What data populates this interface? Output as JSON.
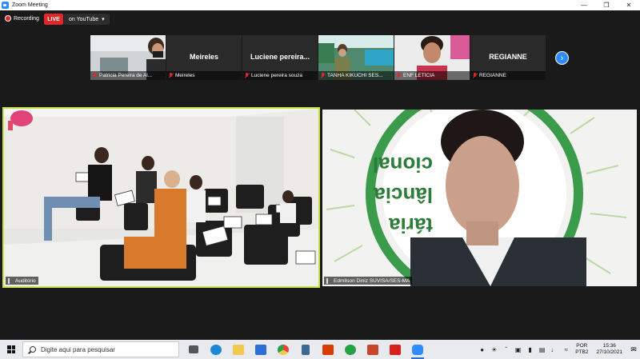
{
  "window": {
    "title": "Zoom Meeting"
  },
  "toolbar": {
    "recording_label": "Recording",
    "live_label": "LIVE",
    "stream_target": "on YouTube"
  },
  "participants": [
    {
      "name": "Patricia Pereira de Al...",
      "display": "",
      "has_video": true
    },
    {
      "name": "Meireles",
      "display": "Meireles",
      "has_video": false
    },
    {
      "name": "Luciene pereira souza",
      "display": "Luciene pereira...",
      "has_video": false
    },
    {
      "name": "TANHA KIKUCHI  SES...",
      "display": "",
      "has_video": true
    },
    {
      "name": "ENF LETÍCIA",
      "display": "",
      "has_video": true
    },
    {
      "name": "REGIANNE",
      "display": "REGIANNE",
      "has_video": false
    }
  ],
  "main_videos": [
    {
      "name": "Auditório"
    },
    {
      "name": "Edmilson Diniz SUVISA/SES-MA",
      "banner_text": [
        "cional",
        "lância",
        "tária"
      ]
    }
  ],
  "taskbar": {
    "search_placeholder": "Digite aqui para pesquisar",
    "apps": [
      {
        "icon": "task-view-icon",
        "color": "#555555"
      },
      {
        "icon": "edge-icon",
        "color": "#1e88d8"
      },
      {
        "icon": "file-explorer-icon",
        "color": "#f2c94c"
      },
      {
        "icon": "mail-icon",
        "color": "#2b6fd6"
      },
      {
        "icon": "chrome-icon",
        "color": "#e2453c"
      },
      {
        "icon": "calculator-icon",
        "color": "#3d6b8f"
      },
      {
        "icon": "office-icon",
        "color": "#d83b01"
      },
      {
        "icon": "whatsapp-icon",
        "color": "#25a244"
      },
      {
        "icon": "powerpoint-icon",
        "color": "#c8472b"
      },
      {
        "icon": "acrobat-icon",
        "color": "#d9201c"
      },
      {
        "icon": "zoom-icon",
        "color": "#2d8cff"
      }
    ],
    "language": [
      "POR",
      "PTB2"
    ],
    "time": "15:36",
    "date": "27/10/2021"
  }
}
